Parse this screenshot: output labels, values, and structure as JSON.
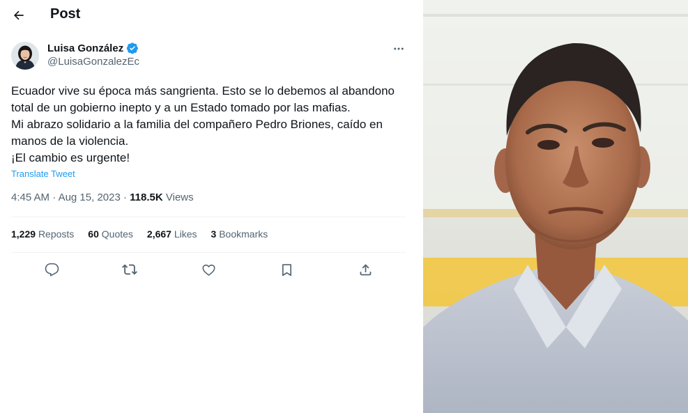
{
  "header": {
    "title": "Post"
  },
  "author": {
    "name": "Luisa González",
    "handle": "@LuisaGonzalezEc"
  },
  "tweet": {
    "lines": [
      "Ecuador vive su época más sangrienta. Esto se lo debemos al abandono",
      "total de un gobierno inepto y a un Estado tomado por las mafias.",
      "Mi abrazo solidario a la familia del compañero Pedro Briones, caído en",
      "manos de la violencia.",
      "¡El cambio es urgente!"
    ],
    "translate_label": "Translate Tweet",
    "time": "4:45 AM",
    "date": "Aug 15, 2023",
    "views_count": "118.5K",
    "views_label": "Views"
  },
  "stats": {
    "reposts_count": "1,229",
    "reposts_label": "Reposts",
    "quotes_count": "60",
    "quotes_label": "Quotes",
    "likes_count": "2,667",
    "likes_label": "Likes",
    "bookmarks_count": "3",
    "bookmarks_label": "Bookmarks"
  },
  "icons": {
    "back": "arrow-left-icon",
    "verified": "verified-badge-icon",
    "more": "more-horizontal-icon",
    "reply": "reply-icon",
    "repost": "repost-icon",
    "like": "heart-icon",
    "bookmark": "bookmark-icon",
    "share": "share-icon"
  },
  "colors": {
    "accent": "#1d9bf0",
    "text_primary": "#0f1419",
    "text_secondary": "#536471",
    "divider": "#eff3f4"
  }
}
